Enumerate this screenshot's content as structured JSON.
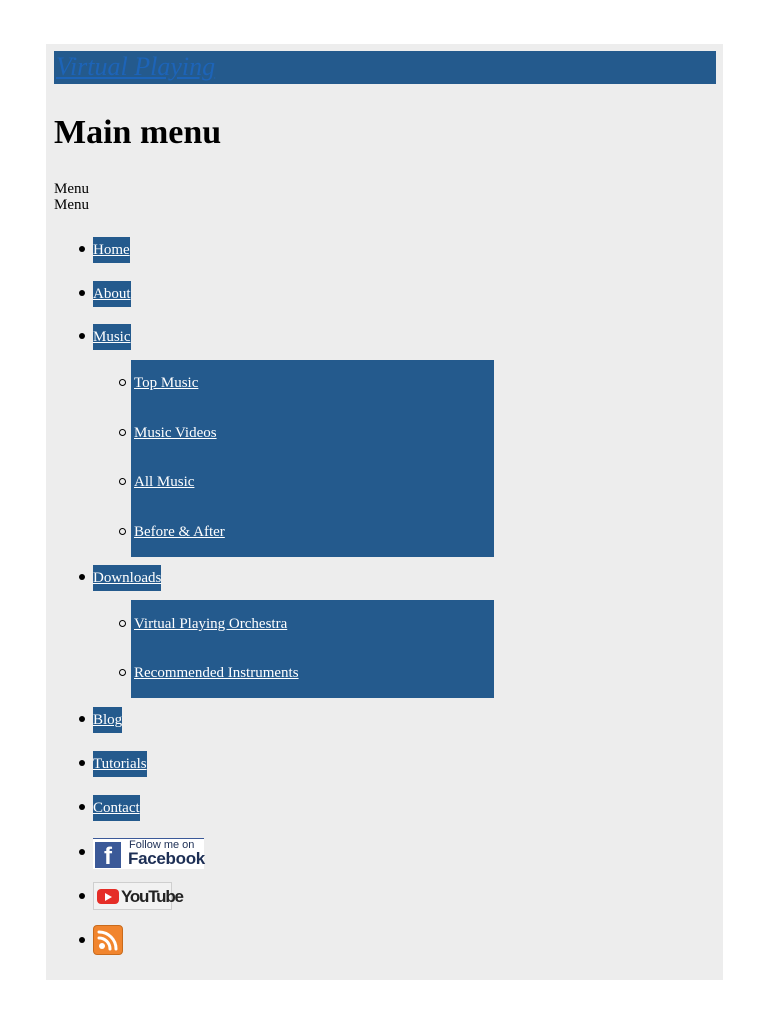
{
  "site": {
    "title": "Virtual Playing"
  },
  "heading": "Main menu",
  "menu_toggles": [
    "Menu",
    "Menu"
  ],
  "nav": {
    "items": [
      {
        "label": "Home"
      },
      {
        "label": "About"
      },
      {
        "label": "Music",
        "submenu": [
          "Top Music",
          "Music Videos",
          "All Music",
          "Before & After"
        ]
      },
      {
        "label": "Downloads",
        "submenu": [
          "Virtual Playing Orchestra",
          "Recommended Instruments"
        ]
      },
      {
        "label": "Blog"
      },
      {
        "label": "Tutorials"
      },
      {
        "label": "Contact"
      }
    ],
    "social": {
      "facebook": {
        "follow_text": "Follow me on",
        "brand": "Facebook",
        "icon_letter": "f"
      },
      "youtube": {
        "brand": "YouTube"
      },
      "rss": {
        "icon": "rss-icon"
      }
    }
  },
  "colors": {
    "accent": "#245a8d",
    "page_bg": "#ededed",
    "title_link": "#1d64b8"
  }
}
